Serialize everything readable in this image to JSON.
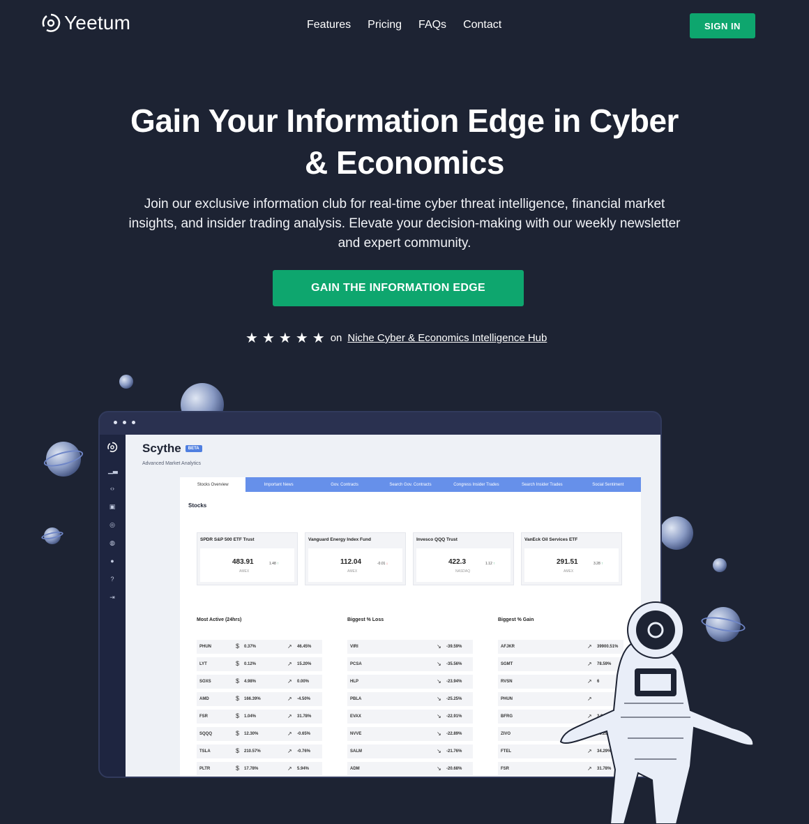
{
  "nav": {
    "logo_text": "Yeetum",
    "links": [
      "Features",
      "Pricing",
      "FAQs",
      "Contact"
    ],
    "signin_label": "SIGN IN"
  },
  "hero": {
    "title_line1": "Gain Your Information Edge in Cyber",
    "title_line2": "& Economics",
    "subtitle": "Join our exclusive information club for real-time cyber threat intelligence, financial market insights, and insider trading analysis. Elevate your decision-making with our weekly newsletter and expert community.",
    "cta_label": "GAIN THE INFORMATION EDGE",
    "rating_stars": 5,
    "rating_on": "on",
    "rating_link": "Niche Cyber & Economics Intelligence Hub"
  },
  "app": {
    "title": "Scythe",
    "badge": "BETA",
    "subtitle": "Advanced Market Analytics",
    "tabs": [
      "Stocks Overview",
      "Important News",
      "Gov. Contracts",
      "Search Gov. Contracts",
      "Congress Insider Trades",
      "Search Insider Trades",
      "Social Sentiment"
    ],
    "active_tab": 0,
    "panel_heading": "Stocks",
    "cards": [
      {
        "name": "SPDR S&P 500 ETF Trust",
        "price": "483.91",
        "exchange": "AMEX",
        "change": "1.48",
        "direction": "up"
      },
      {
        "name": "Vanguard Energy Index Fund",
        "price": "112.04",
        "exchange": "AMEX",
        "change": "-0.01",
        "direction": "down"
      },
      {
        "name": "Invesco QQQ Trust",
        "price": "422.3",
        "exchange": "NASDAQ",
        "change": "1.12",
        "direction": "up"
      },
      {
        "name": "VanEck Oil Services ETF",
        "price": "291.51",
        "exchange": "AMEX",
        "change": "3.28",
        "direction": "up"
      }
    ],
    "most_active": {
      "title": "Most Active (24hrs)",
      "rows": [
        {
          "ticker": "PHUN",
          "pct": "0.37%",
          "change": "46.45%"
        },
        {
          "ticker": "LYT",
          "pct": "0.12%",
          "change": "15.20%"
        },
        {
          "ticker": "SOXS",
          "pct": "4.98%",
          "change": "0.00%"
        },
        {
          "ticker": "AMD",
          "pct": "166.39%",
          "change": "-4.50%"
        },
        {
          "ticker": "FSR",
          "pct": "1.04%",
          "change": "31.78%"
        },
        {
          "ticker": "SQQQ",
          "pct": "12.30%",
          "change": "-0.65%"
        },
        {
          "ticker": "TSLA",
          "pct": "210.57%",
          "change": "-0.76%"
        },
        {
          "ticker": "PLTR",
          "pct": "17.78%",
          "change": "5.94%"
        }
      ]
    },
    "biggest_loss": {
      "title": "Biggest % Loss",
      "rows": [
        {
          "ticker": "VIRI",
          "change": "-39.59%"
        },
        {
          "ticker": "PCSA",
          "change": "-35.56%"
        },
        {
          "ticker": "HLP",
          "change": "-23.94%"
        },
        {
          "ticker": "PBLA",
          "change": "-25.25%"
        },
        {
          "ticker": "EVAX",
          "change": "-22.91%"
        },
        {
          "ticker": "NVVE",
          "change": "-22.89%"
        },
        {
          "ticker": "SALM",
          "change": "-21.76%"
        },
        {
          "ticker": "ADM",
          "change": "-20.68%"
        }
      ]
    },
    "biggest_gain": {
      "title": "Biggest % Gain",
      "rows": [
        {
          "ticker": "AFJKR",
          "change": "39900.51%"
        },
        {
          "ticker": "SGMT",
          "change": "78.59%"
        },
        {
          "ticker": "RVSN",
          "change": "6"
        },
        {
          "ticker": "PHUN",
          "change": ""
        },
        {
          "ticker": "BFRG",
          "change": "3.91%"
        },
        {
          "ticker": "ZIVO",
          "change": "36.29%"
        },
        {
          "ticker": "FTEL",
          "change": "34.29%"
        },
        {
          "ticker": "FSR",
          "change": "31.78%"
        }
      ]
    }
  },
  "colors": {
    "background": "#1d2333",
    "accent": "#0ea66e",
    "tab_blue": "#6690ea"
  }
}
